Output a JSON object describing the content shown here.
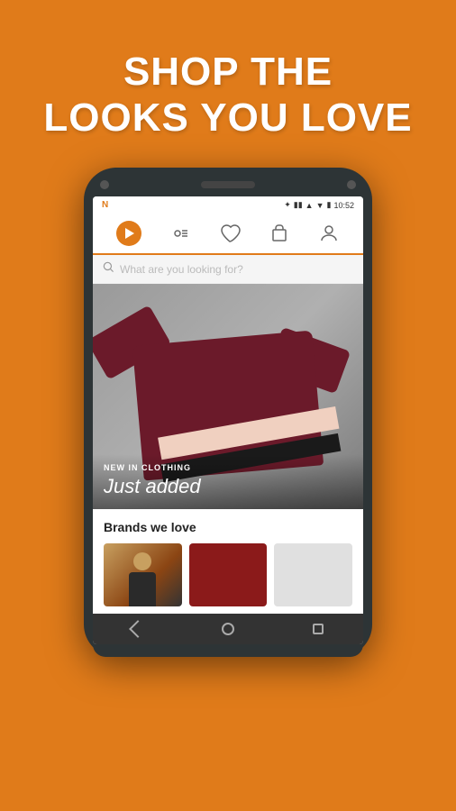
{
  "hero": {
    "line1": "SHOP THE",
    "line2": "LOOKS YOU LOVE"
  },
  "status_bar": {
    "app_initial": "N",
    "time": "10:52",
    "bluetooth": "⚡",
    "vibrate": "📳",
    "signal": "▲",
    "battery": "🔋"
  },
  "nav": {
    "items": [
      {
        "id": "play",
        "label": "Home",
        "active": true
      },
      {
        "id": "feed",
        "label": "Feed"
      },
      {
        "id": "wishlist",
        "label": "Wishlist"
      },
      {
        "id": "cart",
        "label": "Cart"
      },
      {
        "id": "account",
        "label": "Account"
      }
    ]
  },
  "search": {
    "placeholder": "What are you looking for?"
  },
  "banner": {
    "subtitle": "NEW IN CLOTHING",
    "title": "Just added"
  },
  "brands": {
    "section_title": "Brands we love",
    "items": [
      {
        "id": "brand-1",
        "bg": "#8B4513"
      },
      {
        "id": "brand-2",
        "bg": "#8B1A1A"
      },
      {
        "id": "brand-3",
        "bg": "#e0e0e0"
      }
    ]
  },
  "bottom_nav": {
    "items": [
      "back",
      "home",
      "recents"
    ]
  },
  "colors": {
    "primary": "#E07B1A",
    "dark": "#2d3436",
    "white": "#ffffff"
  }
}
